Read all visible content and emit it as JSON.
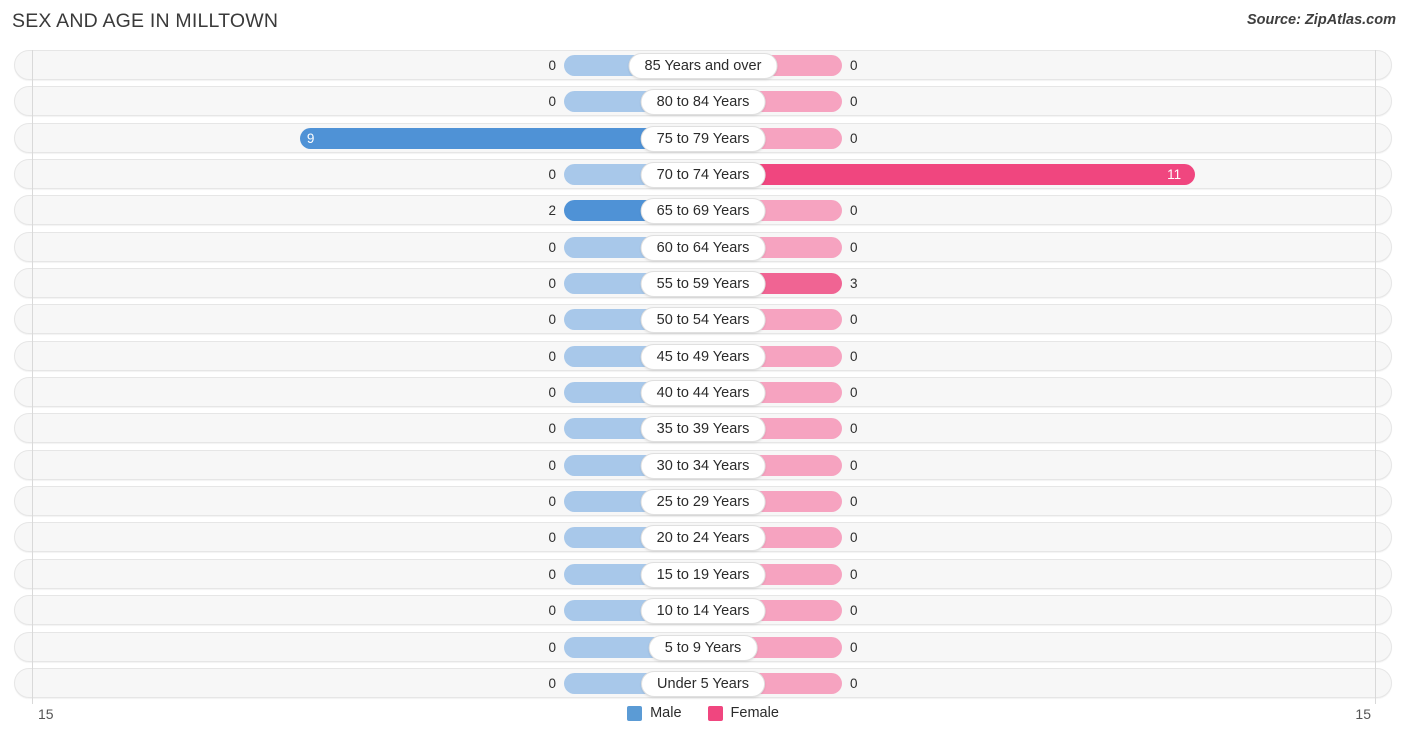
{
  "header": {
    "title": "SEX AND AGE IN MILLTOWN",
    "source": "Source: ZipAtlas.com"
  },
  "legend": {
    "male_label": "Male",
    "female_label": "Female",
    "male_color": "#5b9bd5",
    "female_color": "#f0467f"
  },
  "axis": {
    "left_max": "15",
    "right_max": "15"
  },
  "chart_data": {
    "type": "bar",
    "subtype": "population-pyramid",
    "title": "SEX AND AGE IN MILLTOWN",
    "xlabel": "",
    "ylabel": "",
    "xlim": [
      15,
      15
    ],
    "grid": false,
    "legend_position": "bottom-center",
    "categories": [
      "85 Years and over",
      "80 to 84 Years",
      "75 to 79 Years",
      "70 to 74 Years",
      "65 to 69 Years",
      "60 to 64 Years",
      "55 to 59 Years",
      "50 to 54 Years",
      "45 to 49 Years",
      "40 to 44 Years",
      "35 to 39 Years",
      "30 to 34 Years",
      "25 to 29 Years",
      "20 to 24 Years",
      "15 to 19 Years",
      "10 to 14 Years",
      "5 to 9 Years",
      "Under 5 Years"
    ],
    "series": [
      {
        "name": "Male",
        "color": "#5b9bd5",
        "values": [
          0,
          0,
          9,
          0,
          2,
          0,
          0,
          0,
          0,
          0,
          0,
          0,
          0,
          0,
          0,
          0,
          0,
          0
        ]
      },
      {
        "name": "Female",
        "color": "#f0467f",
        "values": [
          0,
          0,
          0,
          11,
          0,
          0,
          3,
          0,
          0,
          0,
          0,
          0,
          0,
          0,
          0,
          0,
          0,
          0
        ]
      }
    ]
  },
  "rows": [
    {
      "age": "85 Years and over",
      "male": "0",
      "female": "0"
    },
    {
      "age": "80 to 84 Years",
      "male": "0",
      "female": "0"
    },
    {
      "age": "75 to 79 Years",
      "male": "9",
      "female": "0"
    },
    {
      "age": "70 to 74 Years",
      "male": "0",
      "female": "11"
    },
    {
      "age": "65 to 69 Years",
      "male": "2",
      "female": "0"
    },
    {
      "age": "60 to 64 Years",
      "male": "0",
      "female": "0"
    },
    {
      "age": "55 to 59 Years",
      "male": "0",
      "female": "3"
    },
    {
      "age": "50 to 54 Years",
      "male": "0",
      "female": "0"
    },
    {
      "age": "45 to 49 Years",
      "male": "0",
      "female": "0"
    },
    {
      "age": "40 to 44 Years",
      "male": "0",
      "female": "0"
    },
    {
      "age": "35 to 39 Years",
      "male": "0",
      "female": "0"
    },
    {
      "age": "30 to 34 Years",
      "male": "0",
      "female": "0"
    },
    {
      "age": "25 to 29 Years",
      "male": "0",
      "female": "0"
    },
    {
      "age": "20 to 24 Years",
      "male": "0",
      "female": "0"
    },
    {
      "age": "15 to 19 Years",
      "male": "0",
      "female": "0"
    },
    {
      "age": "10 to 14 Years",
      "male": "0",
      "female": "0"
    },
    {
      "age": "5 to 9 Years",
      "male": "0",
      "female": "0"
    },
    {
      "age": "Under 5 Years",
      "male": "0",
      "female": "0"
    }
  ]
}
